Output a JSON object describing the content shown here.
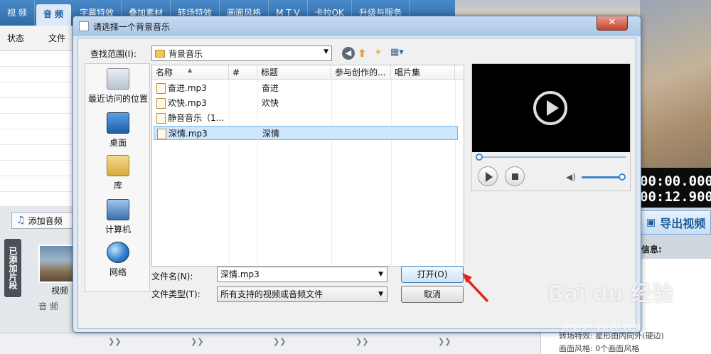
{
  "app": {
    "tabs": [
      "视 频",
      "音 频",
      "字幕特效",
      "叠加素材",
      "转场特效",
      "画面风格",
      "M T V",
      "卡拉OK",
      "升级与服务"
    ],
    "list_header": [
      "状态",
      "文件"
    ],
    "add_audio": "添加音频",
    "added_clips": "已添加片段",
    "clip_label": "视频",
    "audio_label": "音 频",
    "time_start": "00:00.000",
    "time_end": "00:12.900",
    "export": "导出视频",
    "info_title": "信息:",
    "transition_text": "转场特效:   星形由内向外(硬边)",
    "style_text": "画面风格:   0个画面风格"
  },
  "dialog": {
    "title": "请选择一个背景音乐",
    "close": "✕",
    "look_in_label": "查找范围(I):",
    "look_in_value": "背景音乐",
    "places": [
      "最近访问的位置",
      "桌面",
      "库",
      "计算机",
      "网络"
    ],
    "columns": [
      "名称",
      "#",
      "标题",
      "参与创作的...",
      "唱片集"
    ],
    "files": [
      {
        "name": "奋进.mp3",
        "title": "奋进",
        "selected": false
      },
      {
        "name": "欢快.mp3",
        "title": "欢快",
        "selected": false
      },
      {
        "name": "静音音乐（1...",
        "title": "",
        "selected": false
      },
      {
        "name": "深情.mp3",
        "title": "深情",
        "selected": true
      }
    ],
    "filename_label": "文件名(N):",
    "filename_value": "深情.mp3",
    "filetype_label": "文件类型(T):",
    "filetype_value": "所有支持的视频或音频文件",
    "open": "打开(O)",
    "cancel": "取消",
    "seek_fraction": 0.0,
    "volume_fraction": 1.0
  },
  "watermark": {
    "logo": "Bai du 经验",
    "url": "jingyan.baidu.com"
  }
}
